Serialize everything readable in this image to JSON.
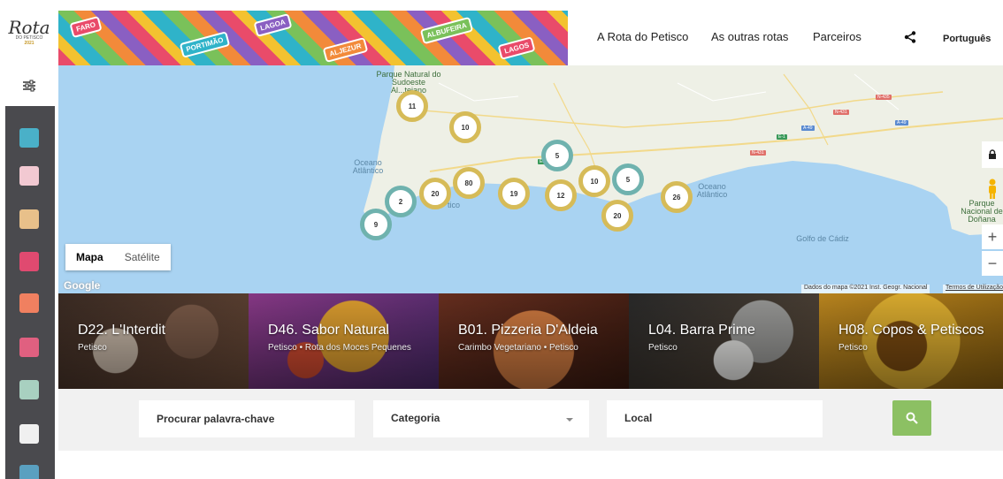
{
  "logo": {
    "line1": "Rota",
    "line2": "DO PETISCO",
    "line3": "2021"
  },
  "banner": {
    "stamps": [
      "FARO",
      "PORTIMÃO",
      "LAGOA",
      "ALJEZUR",
      "ALBUFEIRA",
      "LAGOS"
    ]
  },
  "nav": {
    "item1": "A Rota do Petisco",
    "item2": "As outras rotas",
    "item3": "Parceiros",
    "language": "Português"
  },
  "sidebar": {
    "partners": [
      {
        "label": "",
        "color": "#4ab0c8"
      },
      {
        "label": "",
        "color": "#f2c9d2"
      },
      {
        "label": "",
        "color": "#e8c08a"
      },
      {
        "label": "",
        "color": "#e04a70"
      },
      {
        "label": "",
        "color": "#f08060"
      },
      {
        "label": "",
        "color": "#e06080"
      },
      {
        "label": "",
        "color": "#a8d0c0"
      },
      {
        "label": "",
        "color": "#f0f0f0"
      },
      {
        "label": "",
        "color": "#5aa0c0"
      }
    ]
  },
  "map": {
    "labels": {
      "park_sw": "Parque Natural do Sudoeste Al...tejano",
      "ocean_west": "Oceano Atlântico",
      "ocean_south_fragment": "tico",
      "ocean_east": "Oceano Atlântico",
      "park_donana": "Parque Nacional de Doñana",
      "gulf": "Golfo de Cádiz"
    },
    "roads": [
      "N-435",
      "N-431",
      "A-49",
      "A-49",
      "E-1",
      "N-431",
      "E1"
    ],
    "clusters": [
      {
        "count": "11",
        "style": "gold"
      },
      {
        "count": "10",
        "style": "gold"
      },
      {
        "count": "5",
        "style": "teal"
      },
      {
        "count": "80",
        "style": "gold"
      },
      {
        "count": "20",
        "style": "gold"
      },
      {
        "count": "2",
        "style": "teal"
      },
      {
        "count": "9",
        "style": "teal"
      },
      {
        "count": "19",
        "style": "gold"
      },
      {
        "count": "12",
        "style": "gold"
      },
      {
        "count": "10",
        "style": "gold"
      },
      {
        "count": "5",
        "style": "teal"
      },
      {
        "count": "20",
        "style": "gold"
      },
      {
        "count": "26",
        "style": "gold"
      }
    ],
    "type_map": "Mapa",
    "type_satellite": "Satélite",
    "google": "Google",
    "attribution": "Dados do mapa ©2021 Inst. Geogr. Nacional",
    "terms": "Termos de Utilização"
  },
  "cards": [
    {
      "title": "D22. L'Interdit",
      "subtitle": "Petisco",
      "colors": [
        "#7a5a48",
        "#c8b8a8",
        "#3c2c24"
      ]
    },
    {
      "title": "D46. Sabor Natural",
      "subtitle": "Petisco • Rota dos Moces Pequenes",
      "colors": [
        "#8c3a8a",
        "#e0a030",
        "#4a7a30"
      ]
    },
    {
      "title": "B01. Pizzeria D'Aldeia",
      "subtitle": "Carimbo Vegetariano • Petisco",
      "colors": [
        "#b04a28",
        "#6a3020",
        "#d07a40"
      ]
    },
    {
      "title": "L04. Barra Prime",
      "subtitle": "Petisco",
      "colors": [
        "#3a3a3a",
        "#9a9a98",
        "#5a4a3a"
      ]
    },
    {
      "title": "H08. Copos & Petiscos",
      "subtitle": "Petisco",
      "colors": [
        "#c08a20",
        "#e0b030",
        "#7a4a10"
      ]
    }
  ],
  "search": {
    "keyword_placeholder": "Procurar palavra-chave",
    "category_label": "Categoria",
    "location_placeholder": "Local"
  },
  "colors": {
    "accent_green": "#8cc063",
    "cluster_gold": "#d6bb58",
    "cluster_teal": "#6fb2ae",
    "sea": "#a9d3f2"
  }
}
